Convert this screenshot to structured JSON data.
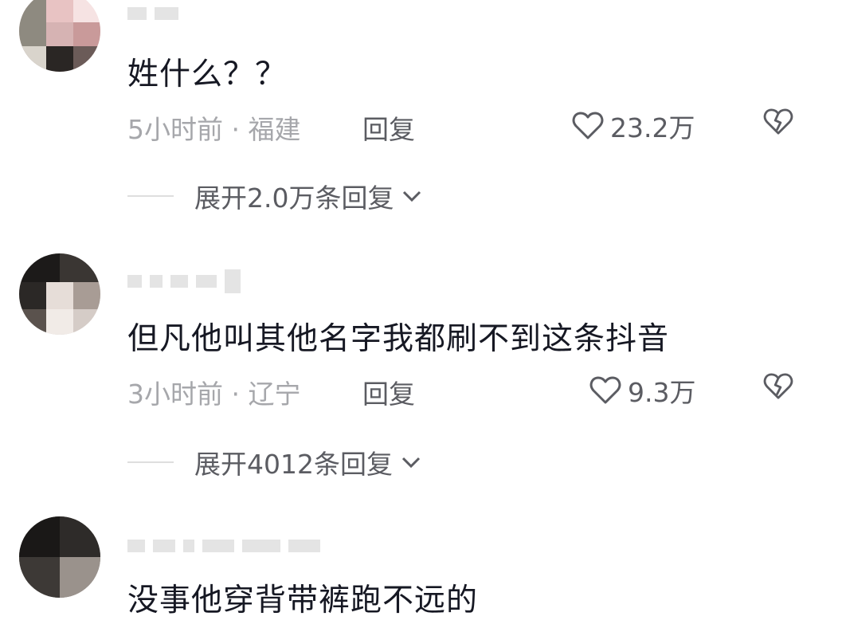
{
  "comments": [
    {
      "text": "姓什么？？",
      "time_region": "5小时前 · 福建",
      "reply_label": "回复",
      "likes": "23.2万",
      "expand_label": "展开2.0万条回复"
    },
    {
      "text": "但凡他叫其他名字我都刷不到这条抖音",
      "time_region": "3小时前 · 辽宁",
      "reply_label": "回复",
      "likes": "9.3万",
      "expand_label": "展开4012条回复"
    },
    {
      "text": "没事他穿背带裤跑不远的"
    }
  ],
  "icons": {
    "like": "heart-outline-icon",
    "dislike": "broken-heart-icon",
    "expand": "chevron-down-icon"
  },
  "colors": {
    "text": "#161823",
    "meta": "#a6a7ab",
    "action": "#5b5c62"
  }
}
